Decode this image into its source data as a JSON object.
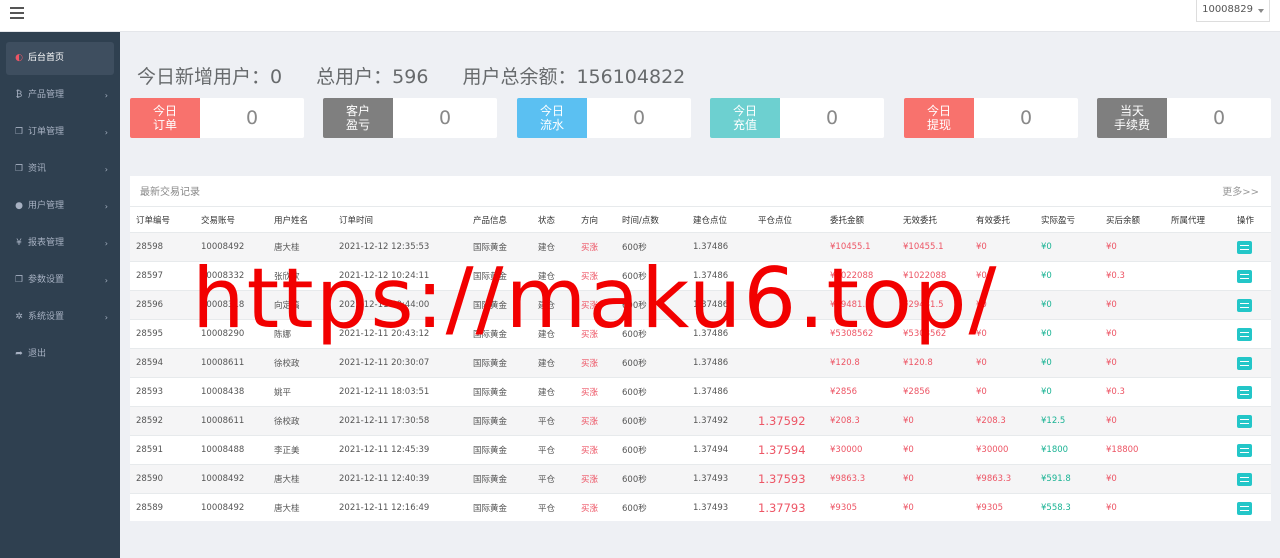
{
  "topbar": {
    "menu_icon": "hamburger-icon",
    "user": "10008829"
  },
  "sidebar": {
    "items": [
      {
        "label": "后台首页",
        "icon": "dashboard-icon",
        "glyph": "◐",
        "active": true,
        "arrow": ""
      },
      {
        "label": "产品管理",
        "icon": "bitcoin-icon",
        "glyph": "₿",
        "arrow": "›"
      },
      {
        "label": "订单管理",
        "icon": "copy-icon",
        "glyph": "❐",
        "arrow": "›"
      },
      {
        "label": "资讯",
        "icon": "copy-icon",
        "glyph": "❐",
        "arrow": "›"
      },
      {
        "label": "用户管理",
        "icon": "user-icon",
        "glyph": "●",
        "arrow": "›"
      },
      {
        "label": "报表管理",
        "icon": "yen-icon",
        "glyph": "¥",
        "arrow": "›"
      },
      {
        "label": "参数设置",
        "icon": "copy-icon",
        "glyph": "❐",
        "arrow": "›"
      },
      {
        "label": "系统设置",
        "icon": "gears-icon",
        "glyph": "✲",
        "arrow": "›"
      },
      {
        "label": "退出",
        "icon": "sign-out-icon",
        "glyph": "➦",
        "arrow": ""
      }
    ]
  },
  "summary": {
    "new_users": "今日新增用户：0",
    "total_users": "总用户：596",
    "total_balance": "用户总余额：156104822"
  },
  "cards": [
    {
      "label": "今日\n订单",
      "value": "0",
      "color": "#f8726d"
    },
    {
      "label": "客户\n盈亏",
      "value": "0",
      "color": "#7f7f7f"
    },
    {
      "label": "今日\n流水",
      "value": "0",
      "color": "#5bc0f2"
    },
    {
      "label": "今日\n充值",
      "value": "0",
      "color": "#6dd0d0"
    },
    {
      "label": "今日\n提现",
      "value": "0",
      "color": "#f8726d"
    },
    {
      "label": "当天\n手续费",
      "value": "0",
      "color": "#7f7f7f"
    }
  ],
  "panel": {
    "title": "最新交易记录",
    "more": "更多>>"
  },
  "table": {
    "headers": [
      "订单编号",
      "交易账号",
      "用户姓名",
      "订单时间",
      "产品信息",
      "状态",
      "方向",
      "时间/点数",
      "建仓点位",
      "平仓点位",
      "委托金额",
      "无效委托",
      "有效委托",
      "实际盈亏",
      "买后余额",
      "所属代理",
      "操作"
    ],
    "rows": [
      [
        "28598",
        "10008492",
        "唐大桂",
        "2021-12-12 12:35:53",
        "国际黄金",
        "建仓",
        "买涨",
        "600秒",
        "1.37486",
        "",
        "¥10455.1",
        "¥10455.1",
        "¥0",
        "¥0",
        "¥0",
        ""
      ],
      [
        "28597",
        "10008332",
        "张欣欣",
        "2021-12-12 10:24:11",
        "国际黄金",
        "建仓",
        "买涨",
        "600秒",
        "1.37486",
        "",
        "¥1022088",
        "¥1022088",
        "¥0",
        "¥0",
        "¥0.3",
        ""
      ],
      [
        "28596",
        "10008318",
        "向定稿",
        "2021-12-11 20:44:00",
        "国际黄金",
        "建仓",
        "买涨",
        "600秒",
        "1.37486",
        "",
        "¥29481.5",
        "¥29481.5",
        "¥0",
        "¥0",
        "¥0",
        ""
      ],
      [
        "28595",
        "10008290",
        "陈娜",
        "2021-12-11 20:43:12",
        "国际黄金",
        "建仓",
        "买涨",
        "600秒",
        "1.37486",
        "",
        "¥5308562",
        "¥5308562",
        "¥0",
        "¥0",
        "¥0",
        ""
      ],
      [
        "28594",
        "10008611",
        "徐校政",
        "2021-12-11 20:30:07",
        "国际黄金",
        "建仓",
        "买涨",
        "600秒",
        "1.37486",
        "",
        "¥120.8",
        "¥120.8",
        "¥0",
        "¥0",
        "¥0",
        ""
      ],
      [
        "28593",
        "10008438",
        "姚平",
        "2021-12-11 18:03:51",
        "国际黄金",
        "建仓",
        "买涨",
        "600秒",
        "1.37486",
        "",
        "¥2856",
        "¥2856",
        "¥0",
        "¥0",
        "¥0.3",
        ""
      ],
      [
        "28592",
        "10008611",
        "徐校政",
        "2021-12-11 17:30:58",
        "国际黄金",
        "平仓",
        "买涨",
        "600秒",
        "1.37492",
        "1.37592",
        "¥208.3",
        "¥0",
        "¥208.3",
        "¥12.5",
        "¥0",
        ""
      ],
      [
        "28591",
        "10008488",
        "李正美",
        "2021-12-11 12:45:39",
        "国际黄金",
        "平仓",
        "买涨",
        "600秒",
        "1.37494",
        "1.37594",
        "¥30000",
        "¥0",
        "¥30000",
        "¥1800",
        "¥18800",
        ""
      ],
      [
        "28590",
        "10008492",
        "唐大桂",
        "2021-12-11 12:40:39",
        "国际黄金",
        "平仓",
        "买涨",
        "600秒",
        "1.37493",
        "1.37593",
        "¥9863.3",
        "¥0",
        "¥9863.3",
        "¥591.8",
        "¥0",
        ""
      ],
      [
        "28589",
        "10008492",
        "唐大桂",
        "2021-12-11 12:16:49",
        "国际黄金",
        "平仓",
        "买涨",
        "600秒",
        "1.37493",
        "1.37793",
        "¥9305",
        "¥0",
        "¥9305",
        "¥558.3",
        "¥0",
        ""
      ]
    ],
    "row_action_icon": "list-icon"
  },
  "watermark": "https://maku6.top/"
}
